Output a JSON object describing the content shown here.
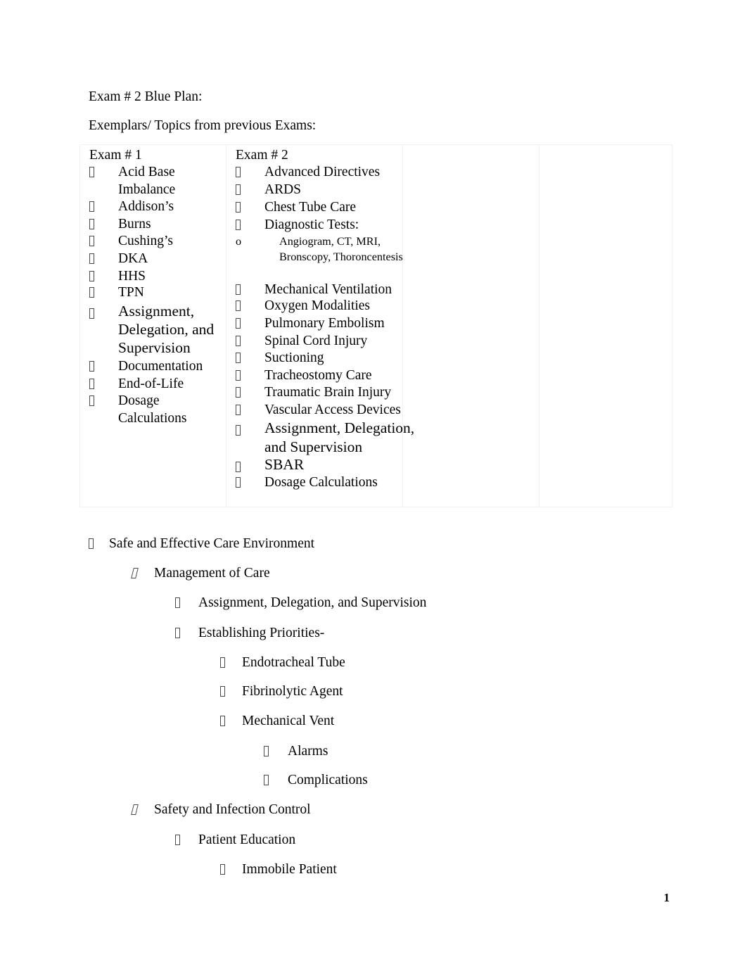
{
  "document": {
    "title_line": "Exam # 2 Blue Plan:",
    "subtitle_line": "Exemplars/ Topics from previous Exams:",
    "page_number": "1",
    "bullet_glyph": "",
    "sub_bullet_glyph": "o",
    "text_color": "#000000",
    "background_color": "#ffffff",
    "table_border_color": "#f1f1f1"
  },
  "table": {
    "columns": [
      {
        "header": "Exam # 1"
      },
      {
        "header": "Exam # 2"
      },
      {
        "header": ""
      },
      {
        "header": ""
      }
    ],
    "exam1_items": [
      {
        "text": "Acid Base Imbalance",
        "wraps": true,
        "large": false
      },
      {
        "text": "Addison’s",
        "wraps": false,
        "large": false
      },
      {
        "text": "Burns",
        "wraps": false,
        "large": false
      },
      {
        "text": "Cushing’s",
        "wraps": false,
        "large": false
      },
      {
        "text": "DKA",
        "wraps": false,
        "large": false
      },
      {
        "text": "HHS",
        "wraps": false,
        "large": false
      },
      {
        "text": "TPN",
        "wraps": false,
        "large": false
      },
      {
        "text": "Assignment, Delegation, and Supervision",
        "wraps": true,
        "large": true
      },
      {
        "text": "Documentation",
        "wraps": false,
        "large": false
      },
      {
        "text": "End-of-Life",
        "wraps": false,
        "large": false
      },
      {
        "text": "Dosage Calculations",
        "wraps": true,
        "large": false
      }
    ],
    "exam2_items": [
      {
        "text": "Advanced Directives",
        "wraps": false,
        "large": false
      },
      {
        "text": "ARDS",
        "wraps": false,
        "large": false
      },
      {
        "text": "Chest Tube Care",
        "wraps": false,
        "large": false
      },
      {
        "text": "Diagnostic Tests:",
        "wraps": false,
        "large": false
      },
      {
        "text": "Mechanical Ventilation",
        "wraps": false,
        "large": false
      },
      {
        "text": "Oxygen Modalities",
        "wraps": false,
        "large": false
      },
      {
        "text": "Pulmonary Embolism",
        "wraps": false,
        "large": false
      },
      {
        "text": "Spinal Cord Injury",
        "wraps": false,
        "large": false
      },
      {
        "text": "Suctioning",
        "wraps": false,
        "large": false
      },
      {
        "text": "Tracheostomy Care",
        "wraps": false,
        "large": false
      },
      {
        "text": "Traumatic Brain Injury",
        "wraps": false,
        "large": false
      },
      {
        "text": "Vascular Access Devices",
        "wraps": false,
        "large": false
      },
      {
        "text": "Assignment, Delegation, and Supervision",
        "wraps": true,
        "large": true
      },
      {
        "text": "SBAR",
        "wraps": false,
        "large": true
      },
      {
        "text": "Dosage Calculations",
        "wraps": false,
        "large": false
      }
    ],
    "diagnostic_tests_sub": "Angiogram, CT, MRI, Bronscopy, Thoroncentesis"
  },
  "outline": [
    {
      "level": 1,
      "text": "Safe and Effective Care Environment"
    },
    {
      "level": 2,
      "text": "Management of Care"
    },
    {
      "level": 3,
      "text": "Assignment, Delegation, and Supervision"
    },
    {
      "level": 3,
      "text": "Establishing Priorities-"
    },
    {
      "level": 4,
      "text": "Endotracheal Tube"
    },
    {
      "level": 4,
      "text": "Fibrinolytic Agent"
    },
    {
      "level": 4,
      "text": "Mechanical Vent"
    },
    {
      "level": 5,
      "text": "Alarms"
    },
    {
      "level": 5,
      "text": "Complications"
    },
    {
      "level": 2,
      "text": "Safety and Infection Control"
    },
    {
      "level": 3,
      "text": "Patient Education"
    },
    {
      "level": 4,
      "text": "Immobile Patient"
    }
  ]
}
